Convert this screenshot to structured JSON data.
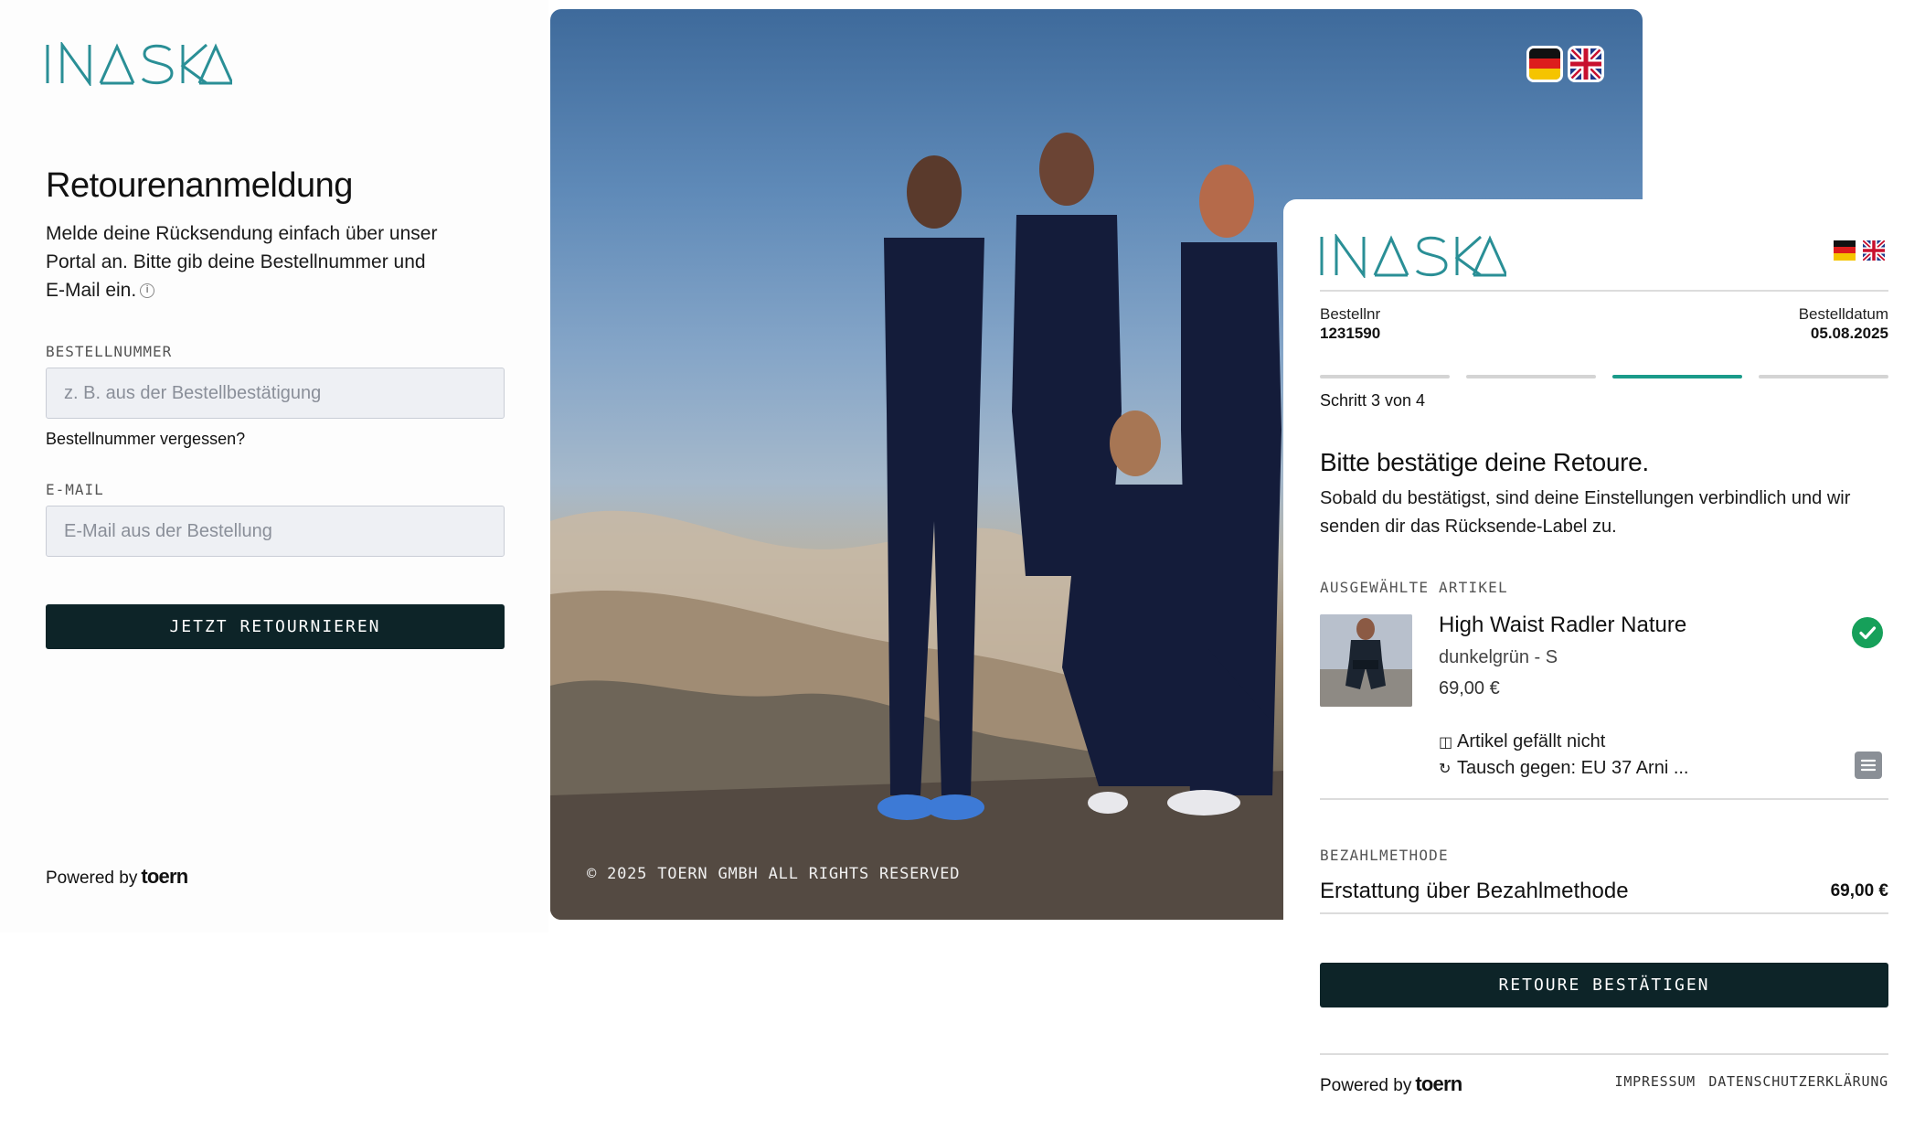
{
  "brand": {
    "logo_text": "INASKA",
    "logo_color": "#2a8f96",
    "accent": "#1a9b8a",
    "button_color": "#0d2428"
  },
  "login": {
    "title": "Retourenanmeldung",
    "description": "Melde deine Rücksendung einfach über unser Portal an. Bitte gib deine Bestellnummer und E-Mail ein.",
    "info_icon": "info-icon",
    "order_label": "BESTELLNUMMER",
    "order_placeholder": "z. B. aus der Bestellbestätigung",
    "order_value": "",
    "forgot_link": "Bestellnummer vergessen?",
    "email_label": "E-MAIL",
    "email_placeholder": "E-Mail aus der Bestellung",
    "email_value": "",
    "submit_button": "JETZT RETOURNIEREN",
    "powered_by": "Powered by",
    "powered_brand": "toern"
  },
  "hero": {
    "copyright": "© 2025 TOERN GMBH ALL RIGHTS RESERVED",
    "languages": [
      {
        "code": "de",
        "icon": "german-flag-icon"
      },
      {
        "code": "en",
        "icon": "uk-flag-icon"
      }
    ]
  },
  "return_card": {
    "order_number_label": "Bestellnr",
    "order_number": "1231590",
    "order_date_label": "Bestelldatum",
    "order_date": "05.08.2025",
    "step": {
      "current": 3,
      "total": 4,
      "text": "Schritt 3 von 4"
    },
    "title": "Bitte bestätige deine Retoure.",
    "description": "Sobald du bestätigst, sind deine Einstellungen verbindlich und wir senden dir das Rücksende-Label zu.",
    "items_label": "AUSGEWÄHLTE ARTIKEL",
    "items": [
      {
        "name": "High Waist Radler Nature",
        "variant": "dunkelgrün - S",
        "price": "69,00 €",
        "selected": true,
        "reason": "Artikel gefällt nicht",
        "reason_icon": "reason-tag-icon",
        "exchange": "Tausch gegen: EU 37 Arni ...",
        "exchange_icon": "exchange-icon"
      }
    ],
    "payment_label": "BEZAHLMETHODE",
    "payment_method": "Erstattung über Bezahlmethode",
    "payment_amount": "69,00 €",
    "confirm_button": "RETOURE BESTÄTIGEN",
    "powered_by": "Powered by",
    "powered_brand": "toern",
    "footer_links": [
      "IMPRESSUM",
      "DATENSCHUTZERKLÄRUNG"
    ],
    "status_color": "#16a05a"
  }
}
